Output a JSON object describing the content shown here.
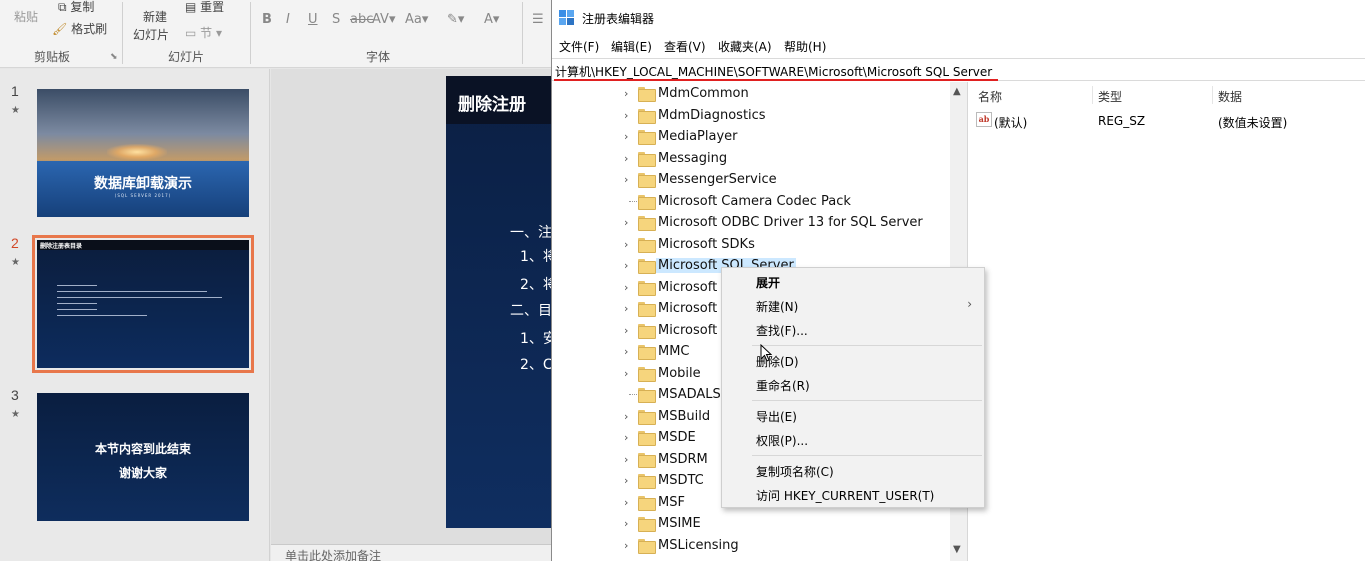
{
  "ppt": {
    "ribbon": {
      "paste_label": "粘贴",
      "copy_label": "复制",
      "format_painter_label": "格式刷",
      "new_slide_label_1": "新建",
      "new_slide_label_2": "幻灯片",
      "reset_label": "重置",
      "section_label": "节",
      "clipboard_group": "剪贴板",
      "slides_group": "幻灯片",
      "font_group": "字体"
    },
    "slides": [
      {
        "num": "1",
        "star": "★",
        "title": "数据库卸载演示",
        "subtitle": "(SQL SERVER 2017)"
      },
      {
        "num": "2",
        "star": "★",
        "title": "删除注册表目录"
      },
      {
        "num": "3",
        "star": "★",
        "line1": "本节内容到此结束",
        "line2": "谢谢大家"
      }
    ],
    "main_slide": {
      "title": "删除注册",
      "lines": [
        "一、注",
        "1、将",
        "2、将",
        "二、目",
        "1、安",
        "2、C"
      ]
    },
    "notes_placeholder": "单击此处添加备注"
  },
  "regedit": {
    "title": "注册表编辑器",
    "menu": [
      "文件(F)",
      "编辑(E)",
      "查看(V)",
      "收藏夹(A)",
      "帮助(H)"
    ],
    "address": "计算机\\HKEY_LOCAL_MACHINE\\SOFTWARE\\Microsoft\\Microsoft SQL Server",
    "tree_items": [
      "MdmCommon",
      "MdmDiagnostics",
      "MediaPlayer",
      "Messaging",
      "MessengerService",
      "Microsoft Camera Codec Pack",
      "Microsoft ODBC Driver 13 for SQL Server",
      "Microsoft SDKs",
      "Microsoft SQL Server",
      "Microsoft S",
      "Microsoft S",
      "Microsoft S",
      "MMC",
      "Mobile",
      "MSADALSC",
      "MSBuild",
      "MSDE",
      "MSDRM",
      "MSDTC",
      "MSF",
      "MSIME",
      "MSLicensing"
    ],
    "columns": {
      "name": "名称",
      "type": "类型",
      "data": "数据"
    },
    "values": [
      {
        "name": "(默认)",
        "type": "REG_SZ",
        "data": "(数值未设置)"
      }
    ],
    "context_menu": {
      "expand": "展开",
      "new": "新建(N)",
      "find": "查找(F)...",
      "delete": "删除(D)",
      "rename": "重命名(R)",
      "export": "导出(E)",
      "permissions": "权限(P)...",
      "copy_key_name": "复制项名称(C)",
      "goto_hkcu": "访问 HKEY_CURRENT_USER(T)"
    }
  }
}
